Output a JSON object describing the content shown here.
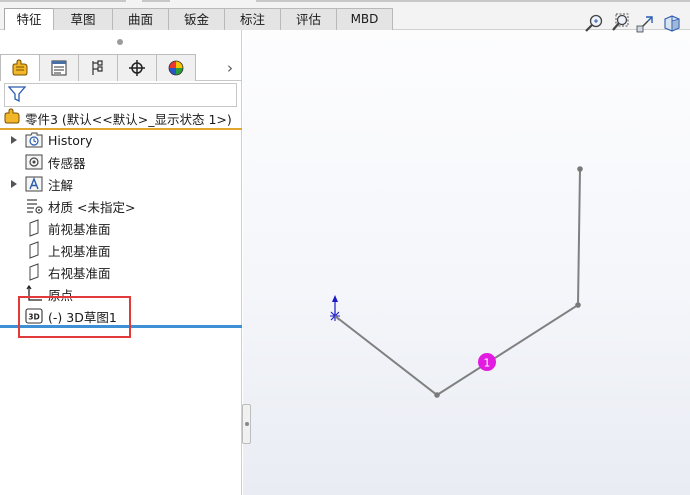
{
  "ribbon": {
    "tabs": [
      {
        "label": "特征",
        "active": true
      },
      {
        "label": "草图",
        "active": false
      },
      {
        "label": "曲面",
        "active": false
      },
      {
        "label": "钣金",
        "active": false
      },
      {
        "label": "标注",
        "active": false
      },
      {
        "label": "评估",
        "active": false
      },
      {
        "label": "MBD",
        "active": false
      }
    ]
  },
  "panel": {
    "tabs": [
      {
        "icon": "feature-manager-icon"
      },
      {
        "icon": "property-manager-icon"
      },
      {
        "icon": "configuration-manager-icon"
      },
      {
        "icon": "dimxpert-icon"
      },
      {
        "icon": "display-manager-icon"
      }
    ],
    "more_icon": "chevron-right-icon",
    "filter_icon": "filter-icon",
    "root": {
      "label": "零件3  (默认<<默认>_显示状态 1>)",
      "icon": "part-icon"
    },
    "tree": [
      {
        "label": "History",
        "icon": "history-icon",
        "expandable": true
      },
      {
        "label": "传感器",
        "icon": "sensor-icon",
        "expandable": false
      },
      {
        "label": "注解",
        "icon": "annotation-icon",
        "expandable": true
      },
      {
        "label": "材质 <未指定>",
        "icon": "material-icon",
        "expandable": false
      },
      {
        "label": "前视基准面",
        "icon": "plane-icon",
        "expandable": false
      },
      {
        "label": "上视基准面",
        "icon": "plane-icon",
        "expandable": false
      },
      {
        "label": "右视基准面",
        "icon": "plane-icon",
        "expandable": false
      },
      {
        "label": "原点",
        "icon": "origin-icon",
        "expandable": false
      },
      {
        "label": "(-) 3D草图1",
        "icon": "3d-sketch-icon",
        "expandable": false
      }
    ]
  },
  "view_tools": [
    "zoom-to-fit-icon",
    "zoom-area-icon",
    "previous-view-icon",
    "section-view-icon"
  ],
  "sketch": {
    "marker_label": "1",
    "colors": {
      "line": "#808080",
      "point": "#7a7a7a",
      "marker": "#e21be0",
      "axis": "#1a1ac8"
    }
  }
}
